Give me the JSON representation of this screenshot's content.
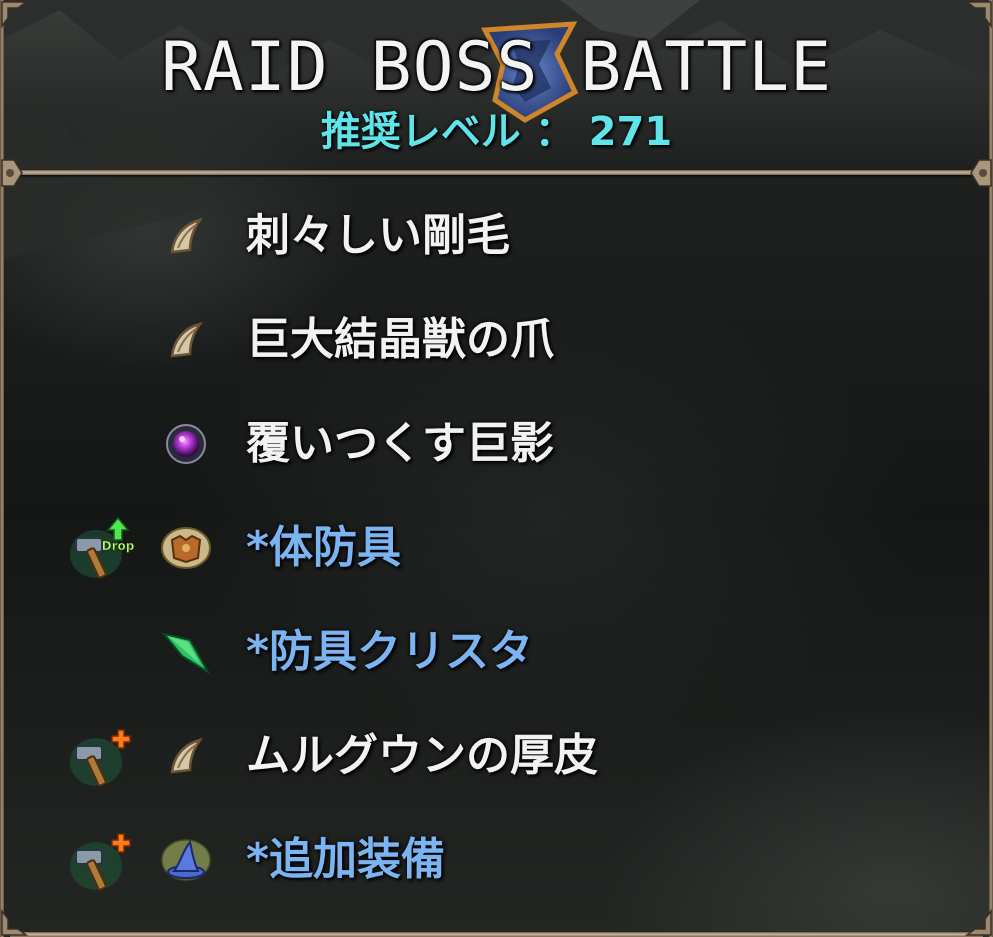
{
  "header": {
    "title": "RAID BOSS BATTLE",
    "level_text": "推奨レベル ： 271"
  },
  "rewards": [
    {
      "name": "刺々しい剛毛",
      "item_icon": "claw-icon",
      "badge_icon": null,
      "color": "#f2f2f2"
    },
    {
      "name": "巨大結晶獣の爪",
      "item_icon": "claw-icon",
      "badge_icon": null,
      "color": "#f2f2f2"
    },
    {
      "name": "覆いつくす巨影",
      "item_icon": "purple-orb-icon",
      "badge_icon": null,
      "color": "#f2f2f2"
    },
    {
      "name": "*体防具",
      "item_icon": "body-armor-icon",
      "badge_icon": "smith-hammer-drop-up-icon",
      "badge_text": "Drop",
      "color": "#7cb4f2"
    },
    {
      "name": "*防具クリスタ",
      "item_icon": "green-crystal-icon",
      "badge_icon": null,
      "color": "#7cb4f2"
    },
    {
      "name": "ムルグウンの厚皮",
      "item_icon": "claw-icon",
      "badge_icon": "smith-hammer-plus-icon",
      "color": "#f2f2f2"
    },
    {
      "name": "*追加装備",
      "item_icon": "wizard-hat-icon",
      "badge_icon": "smith-hammer-plus-icon",
      "color": "#7cb4f2"
    }
  ]
}
